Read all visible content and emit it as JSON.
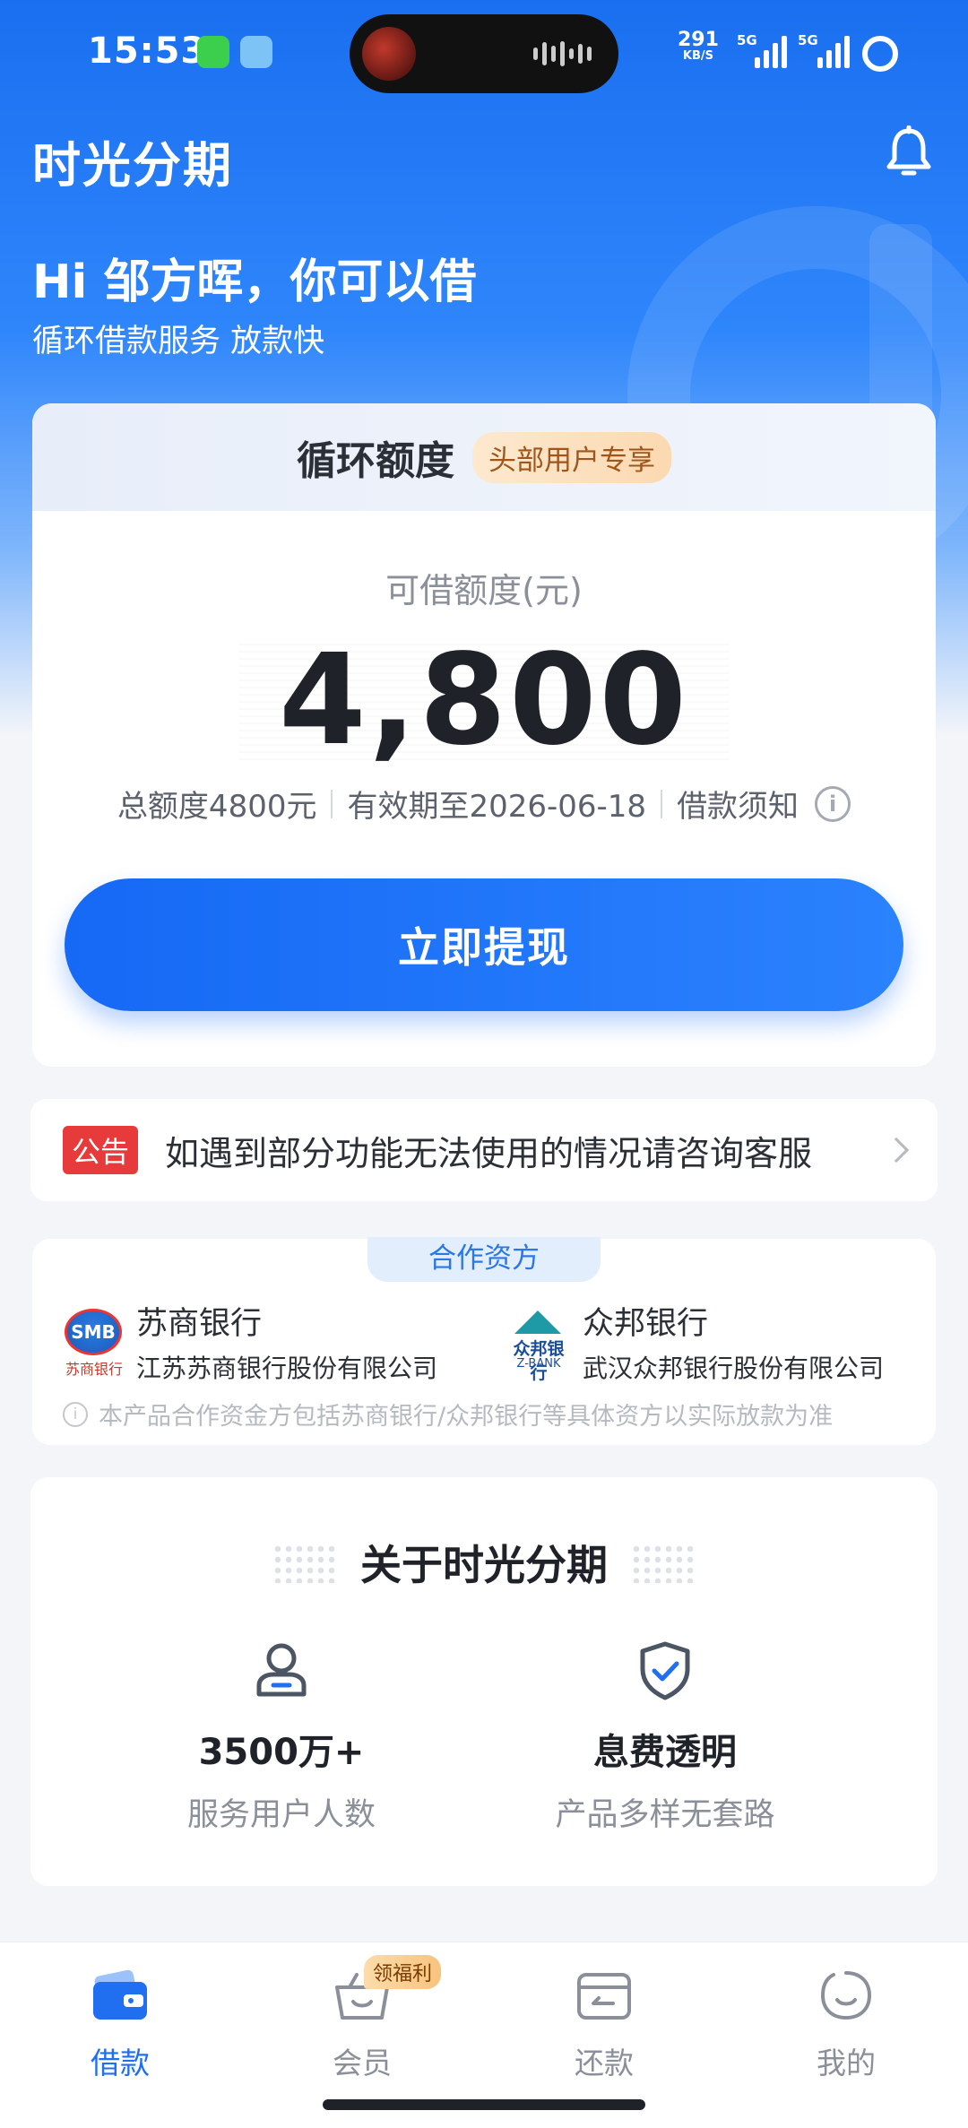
{
  "status_bar": {
    "time": "15:53",
    "net_speed_value": "291",
    "net_speed_unit": "KB/S",
    "sim1_label": "5G",
    "sim2_label": "5G"
  },
  "header": {
    "app_title": "时光分期",
    "greeting": "Hi 邹方晖，你可以借",
    "subgreeting": "循环借款服务 放款快"
  },
  "credit_card": {
    "title": "循环额度",
    "tag": "头部用户专享",
    "limit_label": "可借额度(元)",
    "limit_value": "4,800",
    "total_limit": "总额度4800元",
    "validity": "有效期至2026-06-18",
    "loan_notice": "借款须知",
    "withdraw_label": "立即提现"
  },
  "notice": {
    "tag": "公告",
    "text": "如遇到部分功能无法使用的情况请咨询客服"
  },
  "partners": {
    "tab_label": "合作资方",
    "banks": [
      {
        "logo_text": "SMB",
        "logo_sub": "苏商银行",
        "name": "苏商银行",
        "company": "江苏苏商银行股份有限公司"
      },
      {
        "logo_text": "众邦银行",
        "logo_sub": "Z-BANK",
        "name": "众邦银行",
        "company": "武汉众邦银行股份有限公司"
      }
    ],
    "note": "本产品合作资金方包括苏商银行/众邦银行等具体资方以实际放款为准"
  },
  "about": {
    "title": "关于时光分期",
    "features": [
      {
        "icon": "user-icon",
        "value": "3500万+",
        "desc": "服务用户人数"
      },
      {
        "icon": "shield-check-icon",
        "value": "息费透明",
        "desc": "产品多样无套路"
      }
    ]
  },
  "bottom_nav": {
    "items": [
      {
        "label": "借款",
        "icon": "wallet-icon",
        "active": true
      },
      {
        "label": "会员",
        "icon": "basket-icon",
        "active": false
      },
      {
        "label": "还款",
        "icon": "repay-icon",
        "active": false
      },
      {
        "label": "我的",
        "icon": "smile-icon",
        "active": false
      }
    ],
    "badge": "领福利"
  },
  "colors": {
    "primary": "#1f6ff0",
    "notice_tag": "#e73b3b",
    "vip_tag_text": "#a0561b"
  }
}
